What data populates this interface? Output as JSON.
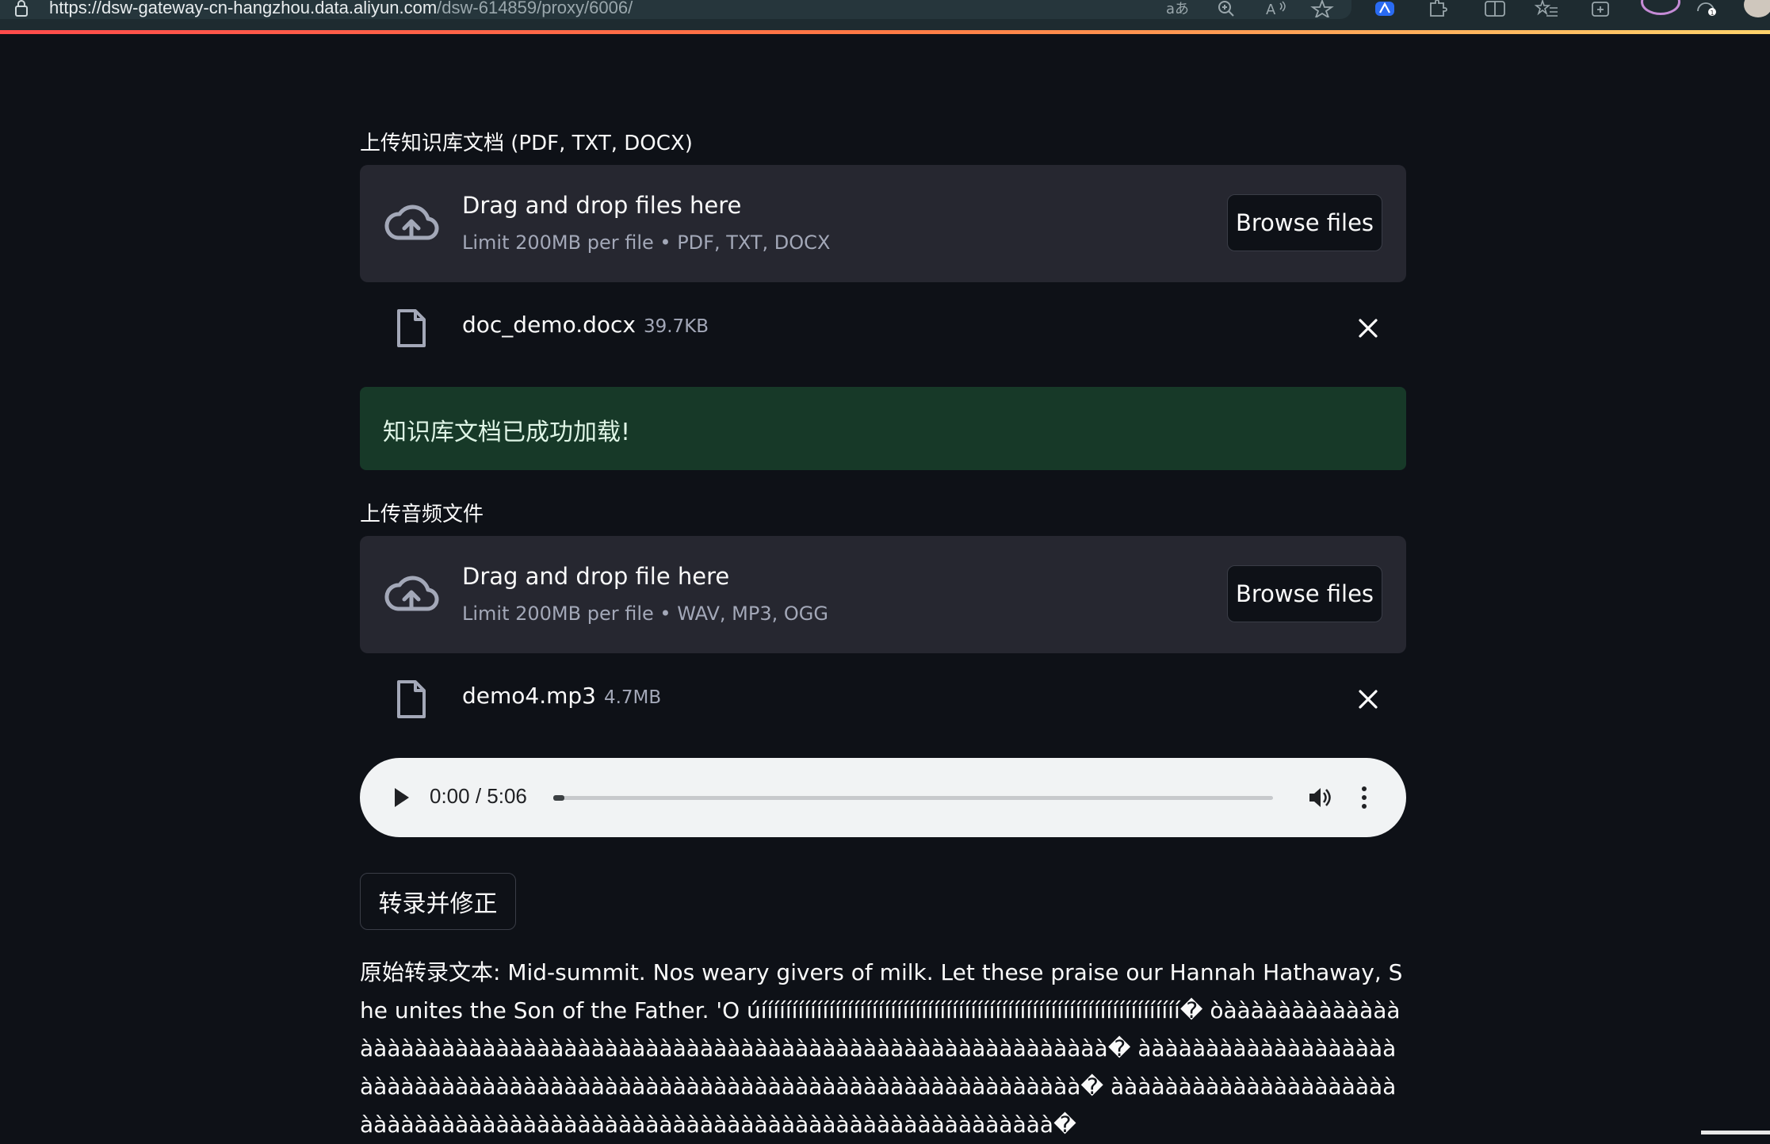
{
  "browser": {
    "url_host": "https://dsw-gateway-cn-hangzhou.data.aliyun.com",
    "url_path": "/dsw-614859/proxy/6006/",
    "icons": [
      "lock-icon",
      "translate-icon",
      "zoom-icon",
      "read-aloud-icon",
      "favorite-star-icon",
      "copilot-icon",
      "extensions-icon",
      "split-screen-icon",
      "favorites-icon",
      "collections-icon",
      "profile-icon",
      "performance-icon",
      "avatar"
    ]
  },
  "knowledge_upload": {
    "label": "上传知识库文档 (PDF, TXT, DOCX)",
    "drop_title": "Drag and drop files here",
    "drop_subtitle": "Limit 200MB per file • PDF, TXT, DOCX",
    "browse_label": "Browse files",
    "file": {
      "name": "doc_demo.docx",
      "size": "39.7KB"
    }
  },
  "success_message": "知识库文档已成功加载!",
  "audio_upload": {
    "label": "上传音频文件",
    "drop_title": "Drag and drop file here",
    "drop_subtitle": "Limit 200MB per file • WAV, MP3, OGG",
    "browse_label": "Browse files",
    "file": {
      "name": "demo4.mp3",
      "size": "4.7MB"
    }
  },
  "audio_player": {
    "time_display": "0:00 / 5:06",
    "progress": 0.0
  },
  "transcribe_button": "转录并修正",
  "transcript": {
    "label": "原始转录文本:",
    "text": "Mid-summit. Nos weary givers of milk. Let these praise our Hannah Hathaway, She unites the Son of the Father. 'O úíííííííííííííííííííííííííííííííííííííííííííííííííííííííííííííííííííí� òàààààààààààààààààààààààààààààààààààààààààààààààààààààààààààààààààààà� àààààààààààààààààààààààààààààààààààààààààààààààààààààààààààààààààààààààà� àààààààààààààààààààààààààààààààààààààààààààààààààààààààààààààààààààààààà�"
  },
  "colors": {
    "background": "#0e1117",
    "dropzone": "#262730",
    "success_bg": "#173928",
    "accent_gradient": [
      "#ff4b4b",
      "#ffd36b"
    ]
  }
}
